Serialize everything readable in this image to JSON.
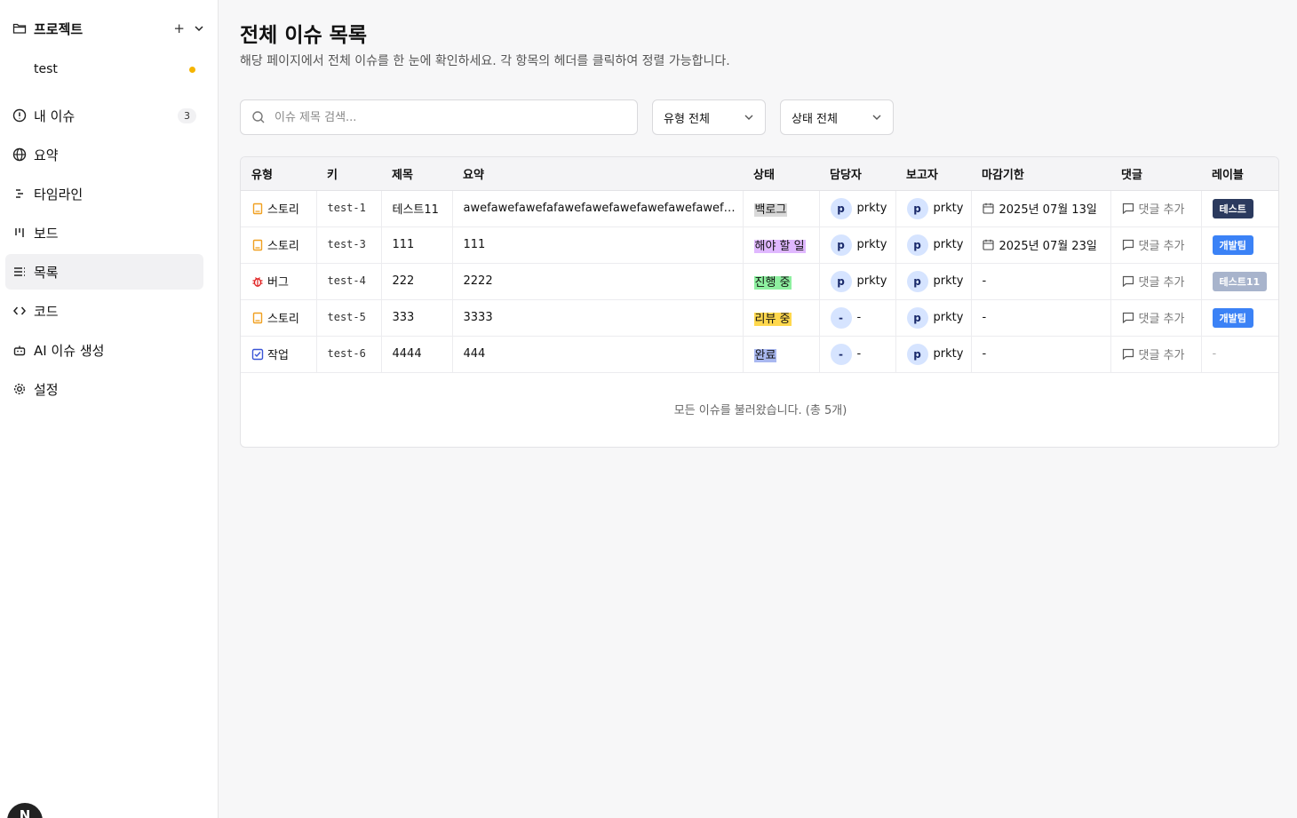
{
  "sidebar": {
    "project_title": "프로젝트",
    "add_icon": "+",
    "project_item": "test",
    "nav": [
      {
        "icon": "alert-circle-icon",
        "label": "내 이슈",
        "count": "3"
      },
      {
        "icon": "globe-icon",
        "label": "요약"
      },
      {
        "icon": "timeline-icon",
        "label": "타임라인"
      },
      {
        "icon": "board-icon",
        "label": "보드"
      },
      {
        "icon": "list-icon",
        "label": "목록",
        "active": true
      },
      {
        "icon": "code-icon",
        "label": "코드"
      },
      {
        "icon": "robot-icon",
        "label": "AI 이슈 생성"
      },
      {
        "icon": "gear-icon",
        "label": "설정"
      }
    ],
    "avatar_letter": "N"
  },
  "page": {
    "title": "전체 이슈 목록",
    "description": "해당 페이지에서 전체 이슈를 한 눈에 확인하세요. 각 항목의 헤더를 클릭하여 정렬 가능합니다."
  },
  "filters": {
    "search_placeholder": "이슈 제목 검색...",
    "type_select": "유형 전체",
    "status_select": "상태 전체"
  },
  "table": {
    "headers": [
      "유형",
      "키",
      "제목",
      "요약",
      "상태",
      "담당자",
      "보고자",
      "마감기한",
      "댓글",
      "레이블"
    ],
    "rows": [
      {
        "type": "스토리",
        "type_icon": "story-icon",
        "key": "test-1",
        "title": "테스트11",
        "summary": "awefawefawefafawefawefawefawefawefawefawefa...",
        "status": "백로그",
        "status_color": "#d9d9d9",
        "assignee_initial": "p",
        "assignee": "prkty",
        "reporter_initial": "p",
        "reporter": "prkty",
        "due": "2025년 07월 13일",
        "comment": "댓글 추가",
        "label": "테스트",
        "label_color": "#2b3a5e"
      },
      {
        "type": "스토리",
        "type_icon": "story-icon",
        "key": "test-3",
        "title": "111",
        "summary": "111",
        "status": "해야 할 일",
        "status_color": "#e0b8ff",
        "assignee_initial": "p",
        "assignee": "prkty",
        "reporter_initial": "p",
        "reporter": "prkty",
        "due": "2025년 07월 23일",
        "comment": "댓글 추가",
        "label": "개발팀",
        "label_color": "#3b82f6"
      },
      {
        "type": "버그",
        "type_icon": "bug-icon",
        "key": "test-4",
        "title": "222",
        "summary": "2222",
        "status": "진행 중",
        "status_color": "#8ef0a0",
        "assignee_initial": "p",
        "assignee": "prkty",
        "reporter_initial": "p",
        "reporter": "prkty",
        "due": "-",
        "comment": "댓글 추가",
        "label": "테스트11",
        "label_color": "#a8b4cc"
      },
      {
        "type": "스토리",
        "type_icon": "story-icon",
        "key": "test-5",
        "title": "333",
        "summary": "3333",
        "status": "리뷰 중",
        "status_color": "#ffd84d",
        "assignee_initial": "-",
        "assignee": "-",
        "reporter_initial": "p",
        "reporter": "prkty",
        "due": "-",
        "comment": "댓글 추가",
        "label": "개발팀",
        "label_color": "#3b82f6"
      },
      {
        "type": "작업",
        "type_icon": "task-icon",
        "key": "test-6",
        "title": "4444",
        "summary": "444",
        "status": "완료",
        "status_color": "#a9b8f0",
        "assignee_initial": "-",
        "assignee": "-",
        "reporter_initial": "p",
        "reporter": "prkty",
        "due": "-",
        "comment": "댓글 추가",
        "label": "-",
        "label_color": ""
      }
    ],
    "footer": "모든 이슈를 불러왔습니다. (총 5개)"
  }
}
